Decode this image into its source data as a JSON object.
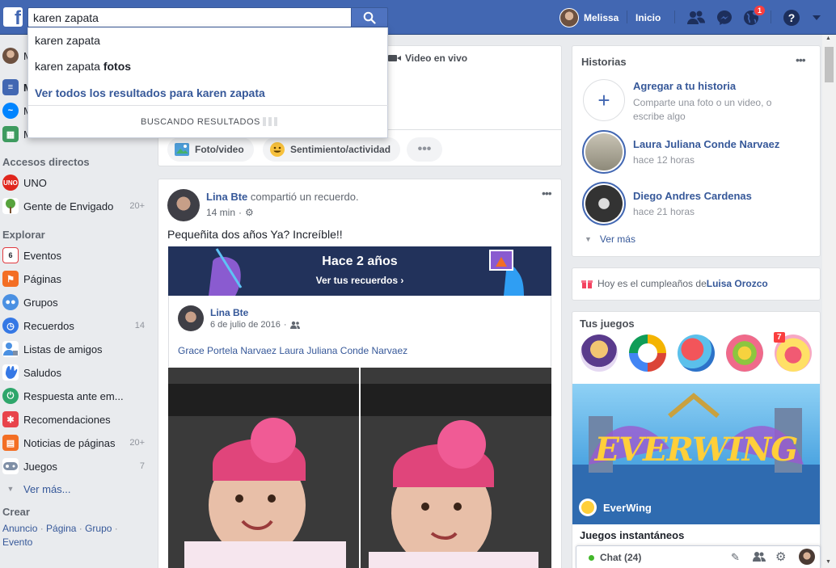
{
  "topbar": {
    "logo": "f",
    "search_value": "karen zapata",
    "user_name": "Melissa",
    "home_label": "Inicio",
    "notif_count": "1",
    "help_label": "?"
  },
  "dropdown": {
    "item1": "karen zapata",
    "item2_prefix": "karen zapata ",
    "item2_bold": "fotos",
    "see_all": "Ver todos los resultados para karen zapata",
    "loading": "BUSCANDO RESULTADOS"
  },
  "sidebar": {
    "partial_items": [
      "M",
      "M",
      "M"
    ],
    "shortcuts_title": "Accesos directos",
    "shortcuts": [
      {
        "label": "UNO",
        "count": ""
      },
      {
        "label": "Gente de Envigado",
        "count": "20+"
      }
    ],
    "explore_title": "Explorar",
    "explore": [
      {
        "label": "Eventos",
        "count": ""
      },
      {
        "label": "Páginas",
        "count": ""
      },
      {
        "label": "Grupos",
        "count": ""
      },
      {
        "label": "Recuerdos",
        "count": "14"
      },
      {
        "label": "Listas de amigos",
        "count": ""
      },
      {
        "label": "Saludos",
        "count": ""
      },
      {
        "label": "Respuesta ante em...",
        "count": ""
      },
      {
        "label": "Recomendaciones",
        "count": ""
      },
      {
        "label": "Noticias de páginas",
        "count": "20+"
      },
      {
        "label": "Juegos",
        "count": "7"
      }
    ],
    "see_more": "Ver más...",
    "create_title": "Crear",
    "create_links": [
      "Anuncio",
      "Página",
      "Grupo",
      "Evento"
    ]
  },
  "composer": {
    "live_video": "Video en vivo",
    "photo_video": "Foto/video",
    "feeling": "Sentimiento/actividad"
  },
  "post": {
    "author": "Lina Bte",
    "action": " compartió un recuerdo.",
    "time": "14 min",
    "text": "Pequeñita dos años Ya? Increíble!!",
    "banner_title": "Hace 2 años",
    "banner_link": "Ver tus recuerdos ›",
    "inner_author": "Lina Bte",
    "inner_date": "6 de julio de 2016",
    "tags": "Grace Portela Narvaez Laura Juliana Conde Narvaez"
  },
  "stories": {
    "title": "Historias",
    "add_title": "Agregar a tu historia",
    "add_sub": "Comparte una foto o un video, o escribe algo",
    "items": [
      {
        "name": "Laura Juliana Conde Narvaez",
        "time": "hace 12 horas"
      },
      {
        "name": "Diego Andres Cardenas",
        "time": "hace 21 horas"
      }
    ],
    "see_more": "Ver más"
  },
  "birthday": {
    "prefix": "Hoy es el cumpleaños de ",
    "name": "Luisa Orozco"
  },
  "games": {
    "title": "Tus juegos",
    "badge": "7",
    "featured_title": "EVERWING",
    "featured_name": "EverWing",
    "instant_title": "Juegos instantáneos"
  },
  "chat": {
    "label": "Chat (24)"
  }
}
